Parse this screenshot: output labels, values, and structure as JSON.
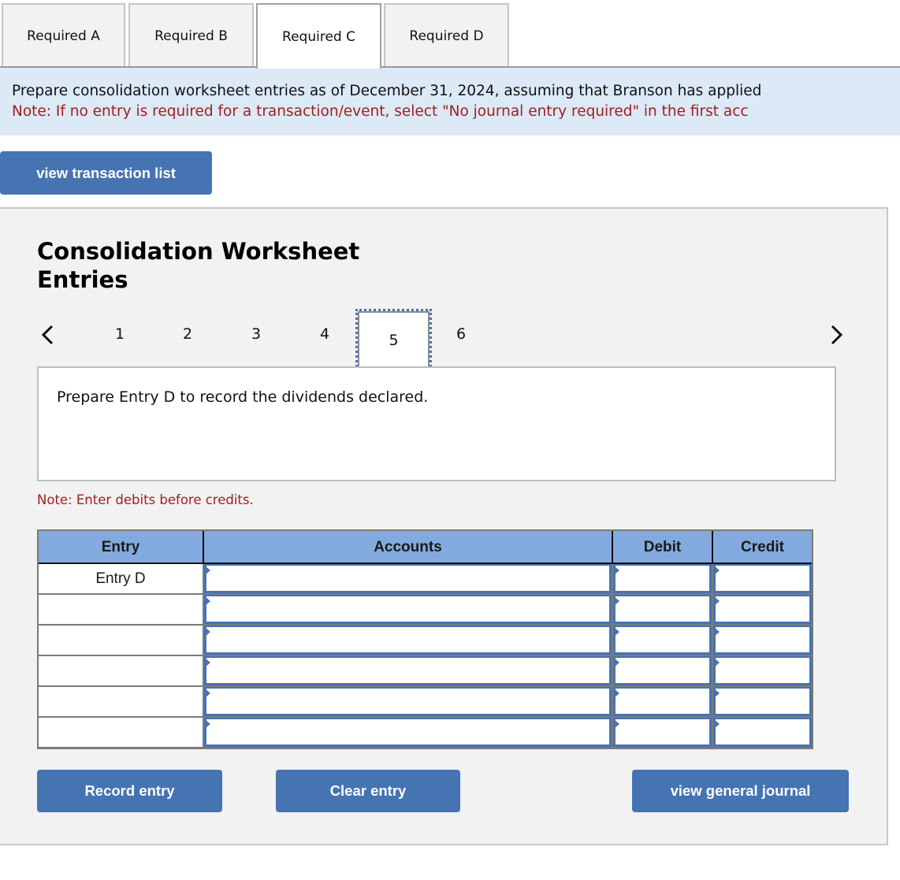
{
  "tabs": [
    {
      "label": "Required A",
      "active": false
    },
    {
      "label": "Required B",
      "active": false
    },
    {
      "label": "Required C",
      "active": true
    },
    {
      "label": "Required D",
      "active": false
    }
  ],
  "banner": {
    "instruction": "Prepare consolidation worksheet entries as of December 31, 2024, assuming that Branson has applied",
    "note": "Note: If no entry is required for a transaction/event, select \"No journal entry required\" in the first acc"
  },
  "view_transaction_list_label": "view transaction list",
  "panel": {
    "title": "Consolidation Worksheet Entries",
    "pager": {
      "prev_icon": "chevron-left-icon",
      "next_icon": "chevron-right-icon",
      "pages": [
        "1",
        "2",
        "3",
        "4",
        "5",
        "6"
      ],
      "current_page": "5"
    },
    "prompt": "Prepare Entry D to record the dividends declared.",
    "debits_note": "Note: Enter debits before credits.",
    "table": {
      "headers": {
        "entry": "Entry",
        "accounts": "Accounts",
        "debit": "Debit",
        "credit": "Credit"
      },
      "rows": [
        {
          "entry": "Entry D",
          "account": "",
          "debit": "",
          "credit": ""
        },
        {
          "entry": "",
          "account": "",
          "debit": "",
          "credit": ""
        },
        {
          "entry": "",
          "account": "",
          "debit": "",
          "credit": ""
        },
        {
          "entry": "",
          "account": "",
          "debit": "",
          "credit": ""
        },
        {
          "entry": "",
          "account": "",
          "debit": "",
          "credit": ""
        },
        {
          "entry": "",
          "account": "",
          "debit": "",
          "credit": ""
        }
      ]
    },
    "buttons": {
      "record": "Record entry",
      "clear": "Clear entry",
      "view_journal": "view general journal"
    }
  },
  "colors": {
    "accent_blue": "#4674b3",
    "header_blue": "#82aadf",
    "banner_bg": "#dce9f6",
    "note_red": "#a51d1d",
    "panel_bg": "#f2f2f2"
  }
}
